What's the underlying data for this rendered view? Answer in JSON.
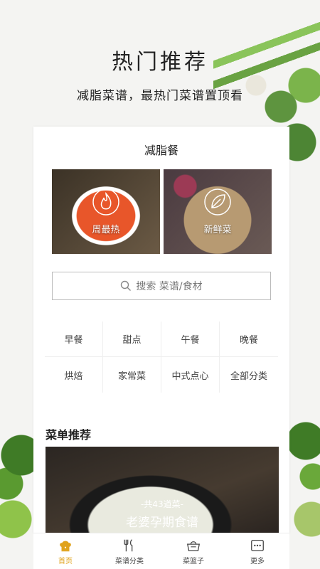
{
  "hero": {
    "title": "热门推荐",
    "subtitle": "减脂菜谱，最热门菜谱置顶看"
  },
  "card": {
    "title": "减脂餐",
    "photos": [
      {
        "label": "周最热",
        "icon": "flame-icon"
      },
      {
        "label": "新鲜菜",
        "icon": "leaf-icon"
      }
    ],
    "search_placeholder": "搜索 菜谱/食材",
    "categories": [
      "早餐",
      "甜点",
      "午餐",
      "晚餐",
      "烘焙",
      "家常菜",
      "中式点心",
      "全部分类"
    ],
    "menu_section_title": "菜单推荐",
    "menu_banner": {
      "count": "-共43道菜-",
      "name": "老婆孕期食谱"
    }
  },
  "tabbar": {
    "items": [
      {
        "label": "首页",
        "icon": "chef-hat-icon",
        "active": true
      },
      {
        "label": "菜谱分类",
        "icon": "utensils-icon",
        "active": false
      },
      {
        "label": "菜篮子",
        "icon": "basket-icon",
        "active": false
      },
      {
        "label": "更多",
        "icon": "more-icon",
        "active": false
      }
    ]
  },
  "colors": {
    "accent": "#e0a21a",
    "background": "#f4f4f2",
    "card": "#ffffff"
  }
}
